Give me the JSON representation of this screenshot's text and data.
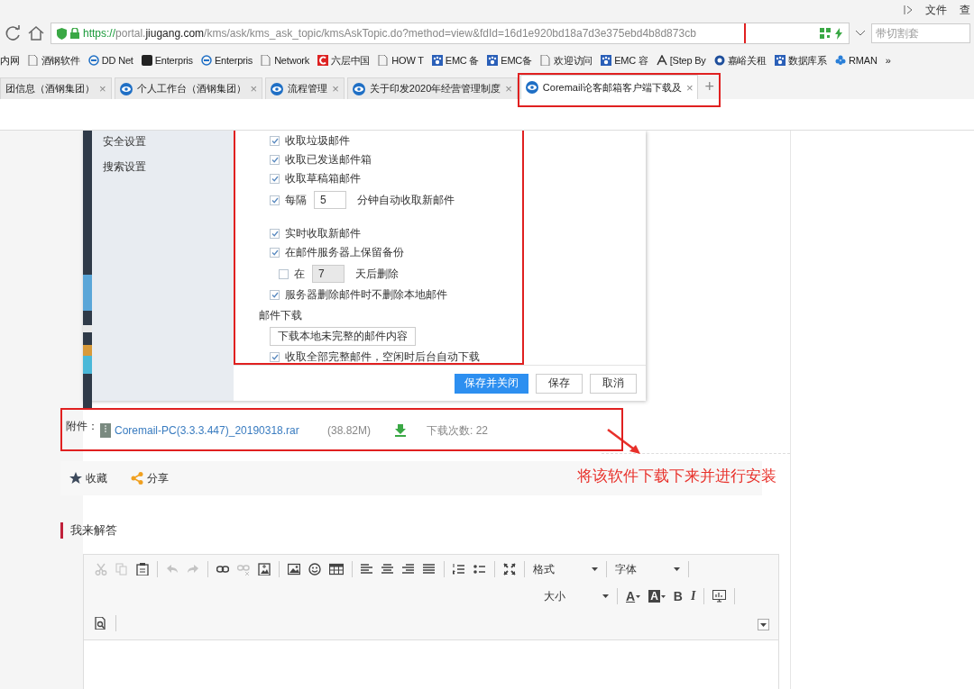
{
  "menu_strip": {
    "items": [
      "文件",
      "查"
    ]
  },
  "address_bar": {
    "url_parts": [
      {
        "kind": "scheme",
        "text": "https://"
      },
      {
        "kind": "host",
        "text": "portal."
      },
      {
        "kind": "domain",
        "text": "jiugang.com"
      },
      {
        "kind": "path",
        "text": "/kms/ask/kms_ask_topic/kmsAskTopic.do?method=view&fdId=16d1e920bd18a7d3e375ebd4b8d873cb"
      }
    ],
    "search_placeholder": "带切割套"
  },
  "bookmarks": [
    {
      "label": "内网",
      "kind": "none"
    },
    {
      "label": "酒钢软件",
      "kind": "page"
    },
    {
      "label": "DD Net",
      "kind": "ring"
    },
    {
      "label": "Enterpris",
      "kind": "dark"
    },
    {
      "label": "Enterpris",
      "kind": "ring"
    },
    {
      "label": "Network",
      "kind": "page"
    },
    {
      "label": "六层中国",
      "kind": "red"
    },
    {
      "label": "HOW T",
      "kind": "page"
    },
    {
      "label": "EMC 备",
      "kind": "paw"
    },
    {
      "label": "EMC备",
      "kind": "paw"
    },
    {
      "label": "欢迎访问",
      "kind": "page"
    },
    {
      "label": "EMC 容",
      "kind": "paw"
    },
    {
      "label": "[Step By",
      "kind": "script"
    },
    {
      "label": "嘉峪关租",
      "kind": "round"
    },
    {
      "label": "数据库系",
      "kind": "paw"
    },
    {
      "label": "RMAN",
      "kind": "flower"
    },
    {
      "label": "»",
      "kind": "none"
    }
  ],
  "tabs": [
    {
      "label": "团信息（酒钢集团）",
      "selected": false,
      "close": "×"
    },
    {
      "label": "个人工作台（酒钢集团）",
      "selected": false,
      "close": "×"
    },
    {
      "label": "流程管理",
      "selected": false,
      "close": "×"
    },
    {
      "label": "关于印发2020年经营管理制度",
      "selected": false,
      "close": "×"
    },
    {
      "label": "Coremail论客邮箱客户端下载及",
      "selected": true,
      "close": "×"
    }
  ],
  "new_tab": "+",
  "dialog": {
    "sidebar": [
      "安全设置",
      "搜索设置"
    ],
    "options": [
      {
        "kind": "check",
        "label": "收取垃圾邮件",
        "checked": true
      },
      {
        "kind": "check",
        "label": "收取已发送邮件箱",
        "checked": true
      },
      {
        "kind": "check",
        "label": "收取草稿箱邮件",
        "checked": true
      },
      {
        "kind": "interval",
        "label": "每隔",
        "value": "5",
        "suffix": "分钟自动收取新邮件",
        "checked": true
      },
      {
        "kind": "gap"
      },
      {
        "kind": "check",
        "label": "实时收取新邮件",
        "checked": true
      },
      {
        "kind": "check",
        "label": "在邮件服务器上保留备份",
        "checked": true
      },
      {
        "kind": "retain",
        "label": "在",
        "value": "7",
        "suffix": "天后删除",
        "checked": false
      },
      {
        "kind": "check",
        "label": "服务器删除邮件时不删除本地邮件",
        "checked": true
      },
      {
        "kind": "heading",
        "label": "邮件下载"
      },
      {
        "kind": "button",
        "label": "下载本地未完整的邮件内容"
      },
      {
        "kind": "check",
        "label": "收取全部完整邮件，空闲时后台自动下载",
        "checked": true
      }
    ],
    "buttons": [
      {
        "label": "保存并关闭",
        "primary": true
      },
      {
        "label": "保存",
        "primary": false
      },
      {
        "label": "取消",
        "primary": false
      }
    ]
  },
  "attachment": {
    "label": "附件：",
    "file": "Coremail-PC(3.3.3.447)_20190318.rar",
    "size": "(38.82M)",
    "downloads": "下载次数: 22"
  },
  "annotation": "将该软件下载下来并进行安装",
  "actions": [
    {
      "kind": "star",
      "label": "收藏"
    },
    {
      "kind": "share",
      "label": "分享"
    }
  ],
  "answer_heading": "我来解答",
  "editor": {
    "rows": [
      [
        {
          "kind": "cut",
          "disabled": true
        },
        {
          "kind": "copy",
          "disabled": true
        },
        {
          "kind": "paste",
          "disabled": false
        },
        {
          "kind": "sep"
        },
        {
          "kind": "undo",
          "disabled": true
        },
        {
          "kind": "redo",
          "disabled": true
        },
        {
          "kind": "sep"
        },
        {
          "kind": "link",
          "disabled": false
        },
        {
          "kind": "unlink",
          "disabled": true
        },
        {
          "kind": "anchor",
          "disabled": false
        },
        {
          "kind": "sep"
        },
        {
          "kind": "image",
          "disabled": false
        },
        {
          "kind": "emoji",
          "disabled": false
        },
        {
          "kind": "table",
          "disabled": false
        },
        {
          "kind": "sep"
        },
        {
          "kind": "align-left",
          "disabled": false
        },
        {
          "kind": "align-center",
          "disabled": false
        },
        {
          "kind": "align-right",
          "disabled": false
        },
        {
          "kind": "justify",
          "disabled": false
        },
        {
          "kind": "sep"
        },
        {
          "kind": "ordered-list",
          "disabled": false
        },
        {
          "kind": "bullet-list",
          "disabled": false
        },
        {
          "kind": "sep"
        },
        {
          "kind": "fullscreen",
          "disabled": false
        },
        {
          "kind": "sep"
        },
        {
          "kind": "dropdown",
          "label": "格式"
        },
        {
          "kind": "sep"
        },
        {
          "kind": "dropdown",
          "label": "字体"
        },
        {
          "kind": "sep"
        }
      ],
      [
        {
          "kind": "dropdown",
          "label": "大小"
        },
        {
          "kind": "sep"
        },
        {
          "kind": "font-color",
          "label": "A"
        },
        {
          "kind": "bg-color",
          "label": "A"
        },
        {
          "kind": "bold",
          "label": "B"
        },
        {
          "kind": "italic",
          "label": "I"
        },
        {
          "kind": "sep"
        },
        {
          "kind": "monitor",
          "disabled": false
        },
        {
          "kind": "sep"
        }
      ],
      [
        {
          "kind": "preview",
          "disabled": false
        },
        {
          "kind": "sep"
        }
      ]
    ]
  }
}
